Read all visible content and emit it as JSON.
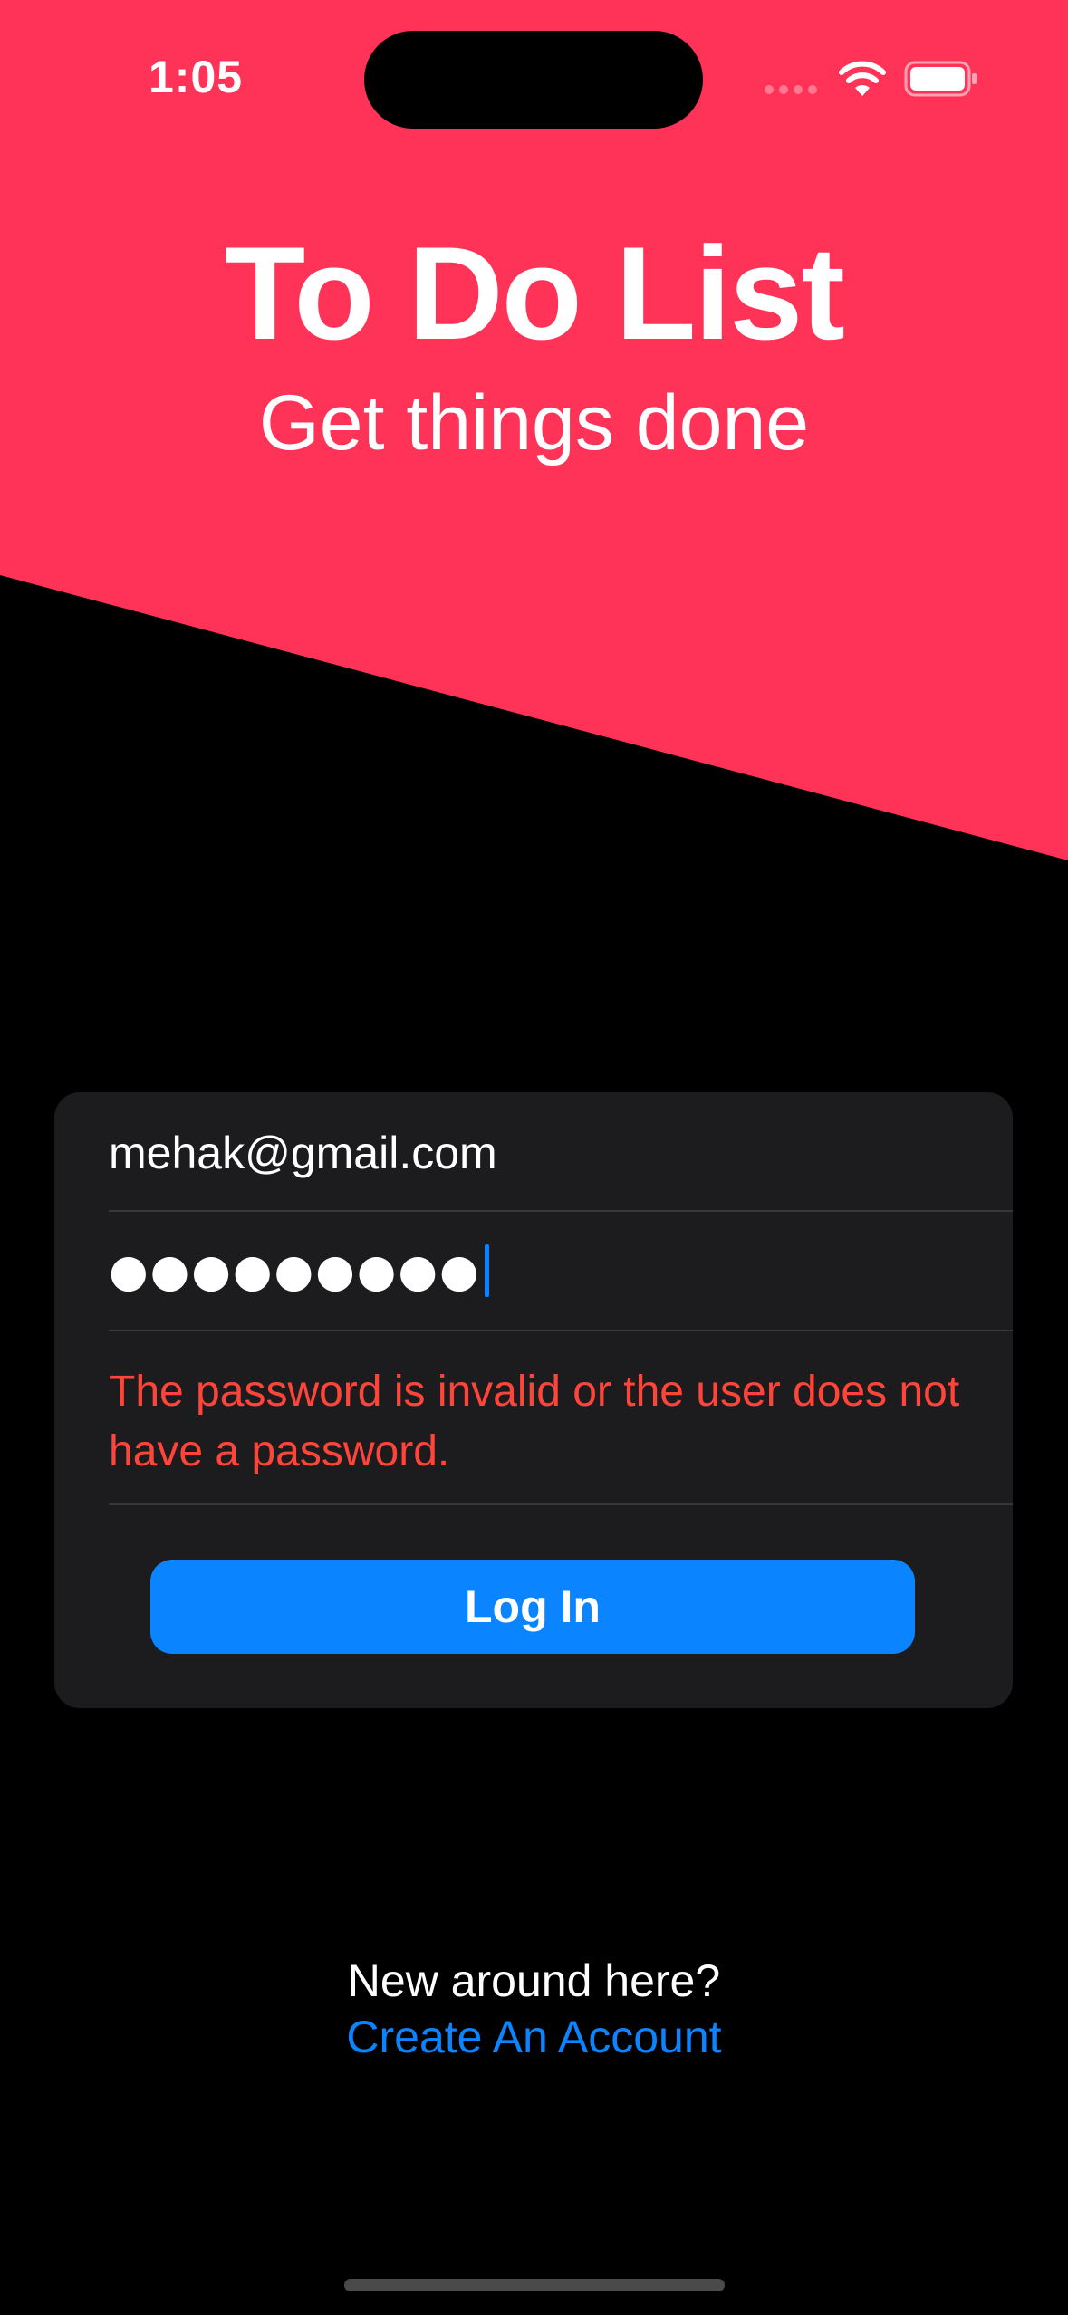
{
  "status_bar": {
    "time": "1:05"
  },
  "header": {
    "title": "To Do List",
    "subtitle": "Get things done",
    "background_color": "#ff3358"
  },
  "form": {
    "email_value": "mehak@gmail.com",
    "password_masked": "●●●●●●●●●",
    "error_message": "The password is invalid or the user does not have a password.",
    "login_label": "Log In",
    "accent_color": "#0a84ff",
    "error_color": "#ff453a"
  },
  "footer": {
    "prompt": "New around here?",
    "create_account_label": "Create An Account"
  }
}
